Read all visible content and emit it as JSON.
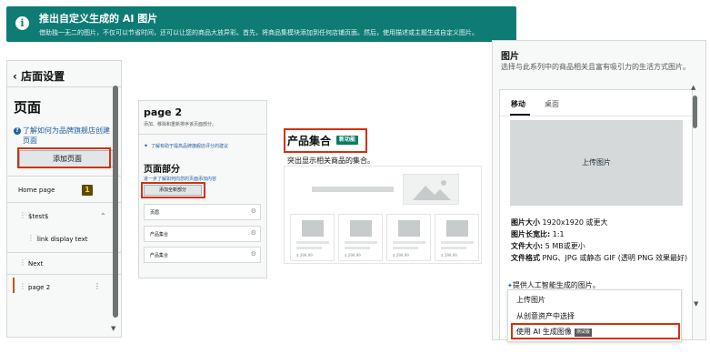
{
  "banner": {
    "icon": "info-icon",
    "title": "推出自定义生成的 AI 图片",
    "description": "借助独一无二的图片，不仅可以节省时间，还可以让您的商品大放异彩。首先，将商品集模块添加到任何店铺页面。然后，使用描述或主题生成自定义图片。"
  },
  "left_panel": {
    "back_label": "店面设置",
    "page_title": "页面",
    "help_link": "了解如何为品牌旗舰店创建页面",
    "add_page_button": "添加页面",
    "nav": [
      {
        "label": "Home page",
        "badge": "1"
      },
      {
        "label": "$test$"
      },
      {
        "label": "link display text"
      },
      {
        "label": "Next"
      },
      {
        "label": "page 2"
      }
    ]
  },
  "middle_panel": {
    "title": "page 2",
    "subtitle": "添加、移除和重新排序该页面部分。",
    "tips_link": "了解有助于提高品牌旗舰店评分的建议",
    "section_title": "页面部分",
    "section_link": "进一步了解如何向您的页面添加内容",
    "add_section_button": "添加全新部分",
    "sections": [
      "页眉",
      "产品集合",
      "产品集合"
    ]
  },
  "collection": {
    "title": "产品集合",
    "badge": "新功能",
    "description": "突出显示相关商品的集合。",
    "price_label": "$ 299.99"
  },
  "right_panel": {
    "title": "图片",
    "description": "选择与此系列中的商品相关且富有吸引力的生活方式图片。",
    "tabs": [
      "移动",
      "桌面"
    ],
    "upload_box_label": "上传图片",
    "specs": {
      "size_label": "图片大小",
      "size_value": "1920x1920 或更大",
      "ratio_label": "图片长宽比:",
      "ratio_value": "1:1",
      "filesize_label": "文件大小:",
      "filesize_value": "5 MB或更小",
      "format_label": "文件格式",
      "format_value": "PNG、JPG 或静态 GIF (透明 PNG 效果最好)"
    },
    "ai_note": "提供人工智能生成的图片。"
  },
  "menu": {
    "items": [
      "上传图片",
      "从创意资产中选择",
      "使用 AI 生成图像"
    ],
    "ai_badge": "测试版"
  },
  "colors": {
    "banner_bg": "#0e7c75",
    "highlight": "#d13212",
    "link": "#2162a1",
    "new_badge": "#067d62"
  }
}
